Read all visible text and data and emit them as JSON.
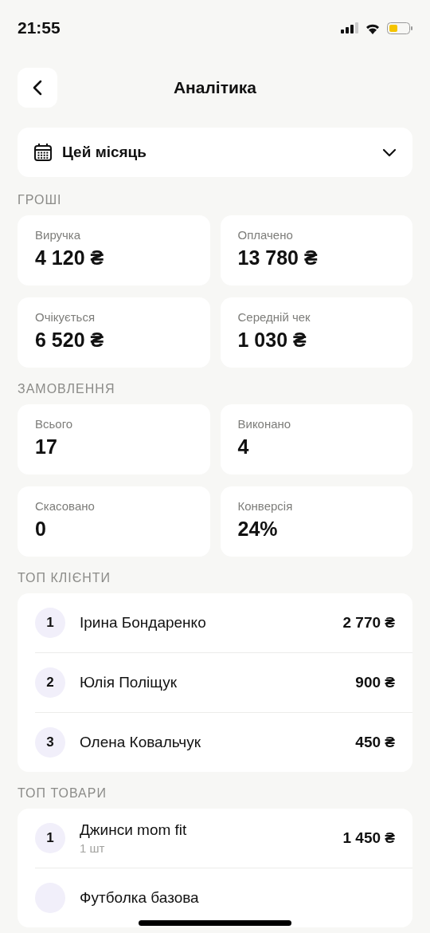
{
  "status_bar": {
    "time": "21:55"
  },
  "header": {
    "title": "Аналітика"
  },
  "period": {
    "label": "Цей місяць"
  },
  "sections": [
    {
      "title": "ГРОШІ",
      "kind": "stats",
      "items": [
        {
          "label": "Виручка",
          "value": "4 120 ₴"
        },
        {
          "label": "Оплачено",
          "value": "13 780 ₴"
        },
        {
          "label": "Очікується",
          "value": "6 520 ₴"
        },
        {
          "label": "Середній чек",
          "value": "1 030 ₴"
        }
      ]
    },
    {
      "title": "ЗАМОВЛЕННЯ",
      "kind": "stats",
      "items": [
        {
          "label": "Всього",
          "value": "17"
        },
        {
          "label": "Виконано",
          "value": "4"
        },
        {
          "label": "Скасовано",
          "value": "0"
        },
        {
          "label": "Конверсія",
          "value": "24%"
        }
      ]
    },
    {
      "title": "ТОП КЛІЄНТИ",
      "kind": "ranking",
      "items": [
        {
          "rank": "1",
          "name": "Ірина Бондаренко",
          "amount": "2 770 ₴"
        },
        {
          "rank": "2",
          "name": "Юлія Поліщук",
          "amount": "900 ₴"
        },
        {
          "rank": "3",
          "name": "Олена Ковальчук",
          "amount": "450 ₴"
        }
      ]
    },
    {
      "title": "ТОП ТОВАРИ",
      "kind": "ranking",
      "items": [
        {
          "rank": "1",
          "name": "Джинси mom fit",
          "note": "1 шт",
          "amount": "1 450 ₴"
        },
        {
          "name": "Футболка базова"
        }
      ]
    }
  ]
}
